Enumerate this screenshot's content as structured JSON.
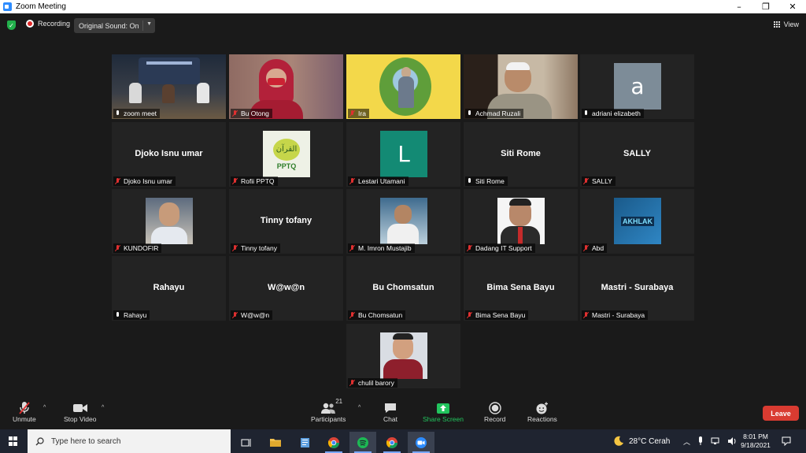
{
  "window": {
    "title": "Zoom Meeting",
    "minimize": "–",
    "restore": "❐",
    "close": "✕"
  },
  "topbar": {
    "recording_label": "Recording",
    "original_sound_label": "Original Sound: On",
    "view_label": "View"
  },
  "participants": [
    {
      "name": "zoom meet",
      "muted": false,
      "active": true,
      "kind": "video-stage"
    },
    {
      "name": "Bu Otong",
      "muted": true,
      "kind": "video-hijab"
    },
    {
      "name": "Ira",
      "muted": true,
      "kind": "video-ira"
    },
    {
      "name": "Achmad Ruzali",
      "muted": false,
      "kind": "video-man"
    },
    {
      "name": "adriani elizabeth",
      "muted": false,
      "kind": "letter",
      "letter": "a",
      "color": "#7d8c98"
    },
    {
      "name": "Djoko Isnu umar",
      "muted": true,
      "kind": "name"
    },
    {
      "name": "Rofii PPTQ",
      "muted": true,
      "kind": "logo-pptq",
      "logo_text": "PPTQ",
      "logo_arabic": "القرآن"
    },
    {
      "name": "Lestari Utamani",
      "muted": true,
      "kind": "letter",
      "letter": "L",
      "color": "#138a74"
    },
    {
      "name": "Siti Rome",
      "muted": false,
      "kind": "name"
    },
    {
      "name": "SALLY",
      "muted": true,
      "kind": "name"
    },
    {
      "name": "KUNDOFIR",
      "muted": true,
      "kind": "photo-kundofir"
    },
    {
      "name": "Tinny tofany",
      "muted": true,
      "kind": "name"
    },
    {
      "name": "M. Imron Mustajib",
      "muted": true,
      "kind": "photo-imron"
    },
    {
      "name": "Dadang IT Support",
      "muted": true,
      "kind": "photo-dadang"
    },
    {
      "name": "Abd",
      "muted": true,
      "kind": "logo-akhlak",
      "logo_text": "AKHLAK"
    },
    {
      "name": "Rahayu",
      "muted": false,
      "kind": "name"
    },
    {
      "name": "W@w@n",
      "muted": true,
      "kind": "name"
    },
    {
      "name": "Bu Chomsatun",
      "muted": true,
      "kind": "name"
    },
    {
      "name": "Bima Sena Bayu",
      "muted": true,
      "kind": "name"
    },
    {
      "name": "Mastri - Surabaya",
      "muted": true,
      "kind": "name"
    },
    {
      "name": "chulil barory",
      "muted": true,
      "kind": "photo-chulil"
    }
  ],
  "toolbar": {
    "unmute": "Unmute",
    "stop_video": "Stop Video",
    "participants": "Participants",
    "participants_count": "21",
    "chat": "Chat",
    "share_screen": "Share Screen",
    "record": "Record",
    "reactions": "Reactions",
    "leave": "Leave"
  },
  "taskbar": {
    "search_placeholder": "Type here to search",
    "weather": "28°C Cerah",
    "time": "8:01 PM",
    "date": "9/18/2021"
  },
  "colors": {
    "accent_green": "#22c55e",
    "leave_red": "#d93b31",
    "active_speaker": "#c8e84a"
  }
}
